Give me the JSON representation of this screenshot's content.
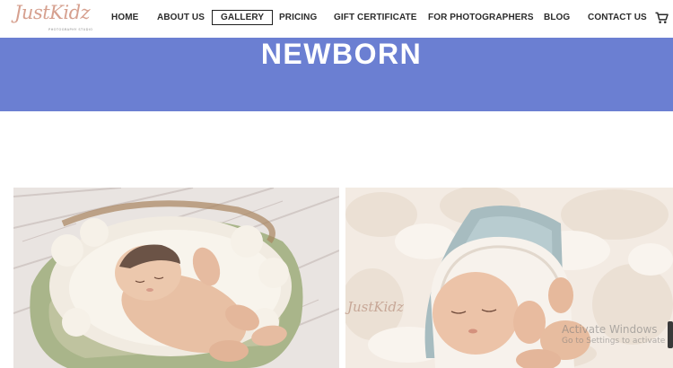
{
  "header": {
    "logo": {
      "script_text": "JustKidz",
      "subtitle": "PHOTOGRAPHY STUDIO"
    },
    "nav": {
      "home": "HOME",
      "about": "ABOUT US",
      "gallery": "GALLERY",
      "pricing": "PRICING",
      "gift": "GIFT CERTIFICATE",
      "photographers": "FOR PHOTOGRAPHERS",
      "blog": "BLOG",
      "contact": "CONTACT US"
    },
    "active_item": "GALLERY",
    "cart_icon": "cart-icon"
  },
  "hero": {
    "title": "NEWBORN",
    "background_color": "#6b7fd2"
  },
  "gallery": {
    "photos": [
      {
        "subject": "newborn-on-fur-in-basket"
      },
      {
        "subject": "newborn-with-pillow-and-wrap"
      }
    ],
    "watermark": "JustKidz"
  },
  "overlay": {
    "activation_title": "Activate Windows",
    "activation_sub": "Go to Settings to activate Windows."
  },
  "colors": {
    "accent": "#6b7fd2",
    "logo": "#d6a08f",
    "text": "#2b2b2b"
  }
}
